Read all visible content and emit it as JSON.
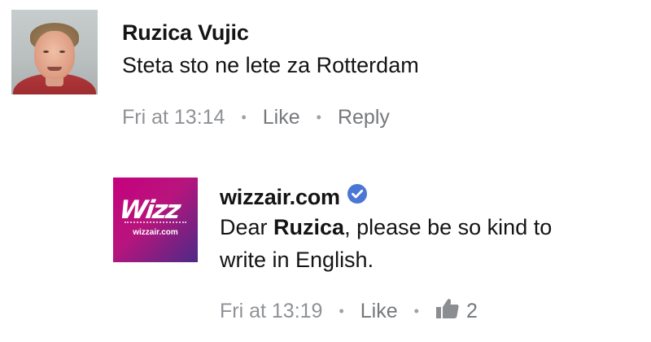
{
  "comments": [
    {
      "author": "Ruzica Vujic",
      "text": "Steta sto ne lete za Rotterdam",
      "time": "Fri at 13:14",
      "like_label": "Like",
      "reply_label": "Reply"
    },
    {
      "author": "wizzair.com",
      "verified": true,
      "text_before": "Dear ",
      "text_bold": "Ruzica",
      "text_after": ", please be so kind to",
      "text_line2": "write in English.",
      "time": "Fri at 13:19",
      "like_label": "Like",
      "like_count": "2",
      "logo_text": "Wizz",
      "logo_url": "wizzair.com"
    }
  ],
  "colors": {
    "meta_grey": "#8a8d91",
    "verified_blue": "#4a76d6",
    "wizz_magenta": "#c6007e",
    "wizz_purple": "#4c2a86"
  },
  "icons": [
    "verified-badge-icon",
    "thumbs-up-icon"
  ]
}
